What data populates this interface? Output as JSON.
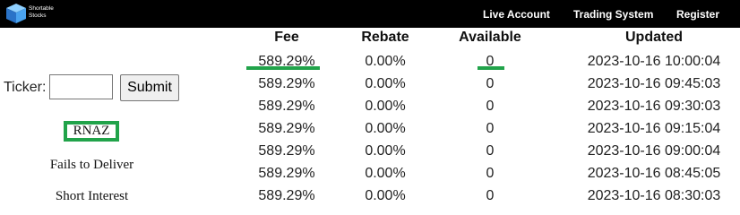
{
  "header": {
    "logo_text": "Shortable Stocks",
    "nav": [
      "Live Account",
      "Trading System",
      "Register"
    ]
  },
  "sidebar": {
    "ticker_label": "Ticker:",
    "ticker_input_value": "",
    "submit_label": "Submit",
    "current_ticker": "RNAZ",
    "links": [
      "Fails to Deliver",
      "Short Interest"
    ]
  },
  "table": {
    "headers": [
      "Fee",
      "Rebate",
      "Available",
      "Updated"
    ],
    "rows": [
      {
        "fee": "589.29%",
        "rebate": "0.00%",
        "available": "0",
        "updated": "2023-10-16 10:00:04"
      },
      {
        "fee": "589.29%",
        "rebate": "0.00%",
        "available": "0",
        "updated": "2023-10-16 09:45:03"
      },
      {
        "fee": "589.29%",
        "rebate": "0.00%",
        "available": "0",
        "updated": "2023-10-16 09:30:03"
      },
      {
        "fee": "589.29%",
        "rebate": "0.00%",
        "available": "0",
        "updated": "2023-10-16 09:15:04"
      },
      {
        "fee": "589.29%",
        "rebate": "0.00%",
        "available": "0",
        "updated": "2023-10-16 09:00:04"
      },
      {
        "fee": "589.29%",
        "rebate": "0.00%",
        "available": "0",
        "updated": "2023-10-16 08:45:05"
      },
      {
        "fee": "589.29%",
        "rebate": "0.00%",
        "available": "0",
        "updated": "2023-10-16 08:30:03"
      }
    ]
  },
  "colors": {
    "highlight": "#21a34a",
    "topbar": "#000000"
  }
}
